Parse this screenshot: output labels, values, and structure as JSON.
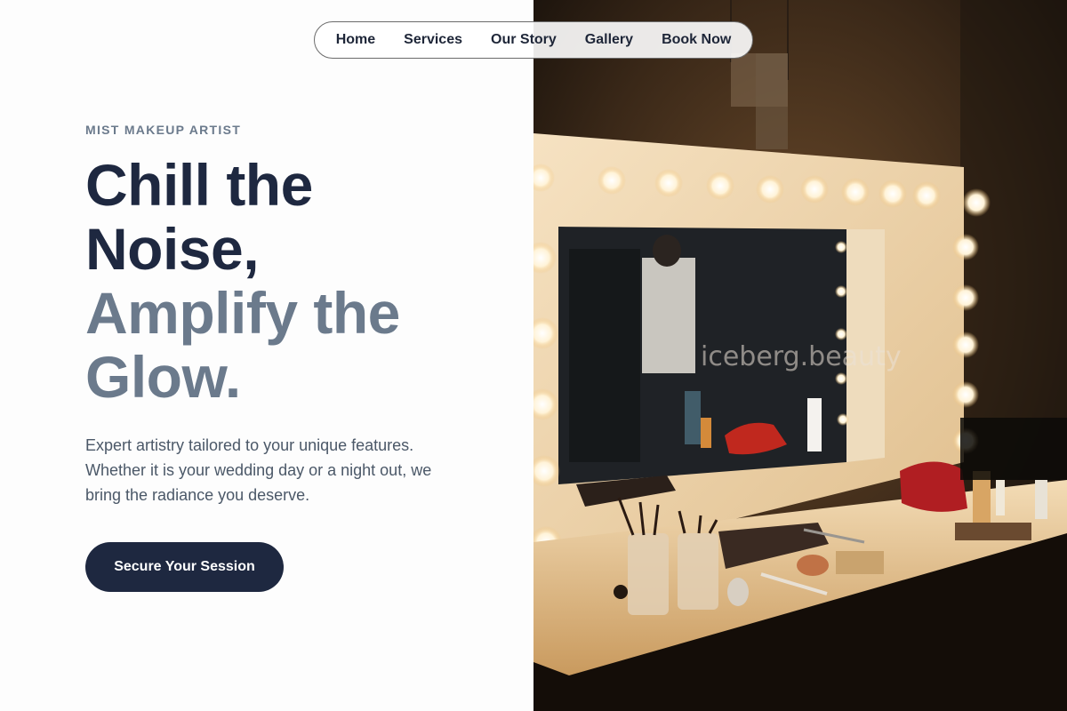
{
  "nav": {
    "items": [
      {
        "label": "Home"
      },
      {
        "label": "Services"
      },
      {
        "label": "Our Story"
      },
      {
        "label": "Gallery"
      },
      {
        "label": "Book Now"
      }
    ]
  },
  "hero": {
    "eyebrow": "MIST MAKEUP ARTIST",
    "headline_dark": [
      "Chill the",
      "Noise,"
    ],
    "headline_light": [
      "Amplify the",
      "Glow."
    ],
    "lead": "Expert artistry tailored to your unique features. Whether it is your wedding day or a night out, we bring the radiance you deserve.",
    "cta_label": "Secure Your Session"
  },
  "photo": {
    "watermark": "iceberg.beauty",
    "subject": "vanity-mirror-with-bulbs-image"
  },
  "colors": {
    "primary_dark": "#1e2840",
    "muted_slate": "#6b7a8c",
    "body_text": "#4b5868",
    "background": "#fdfdfd"
  }
}
